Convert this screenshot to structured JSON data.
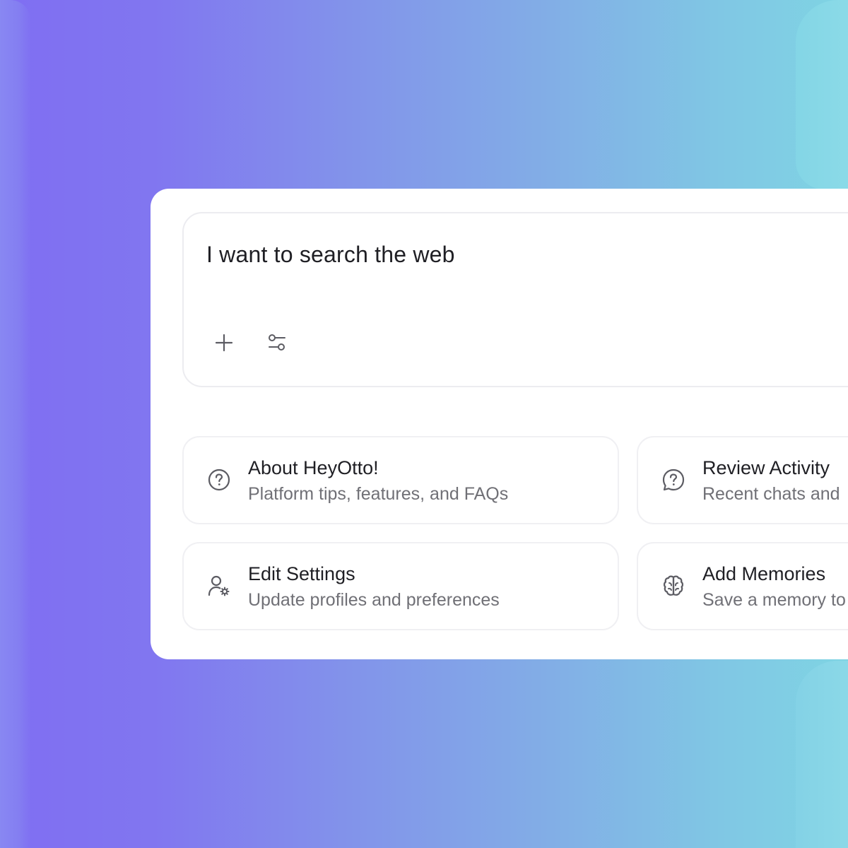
{
  "prompt": {
    "text": "I want to search the web",
    "tools": {
      "add_icon": "plus-icon",
      "settings_icon": "sliders-icon"
    }
  },
  "cards": [
    {
      "title": "About HeyOtto!",
      "subtitle": "Platform tips, features, and FAQs",
      "icon": "question-circle-icon"
    },
    {
      "title": "Review Activity",
      "subtitle": "Recent chats and",
      "icon": "question-bubble-icon"
    },
    {
      "title": "Edit Settings",
      "subtitle": "Update profiles and preferences",
      "icon": "user-gear-icon"
    },
    {
      "title": "Add Memories",
      "subtitle": "Save a memory to",
      "icon": "brain-icon"
    }
  ],
  "colors": {
    "gradient_start": "#7f6ef2",
    "gradient_end": "#7fd4e3",
    "panel": "#ffffff",
    "text_primary": "#1f1f24",
    "text_secondary": "#707076",
    "icon": "#5c5c63"
  }
}
